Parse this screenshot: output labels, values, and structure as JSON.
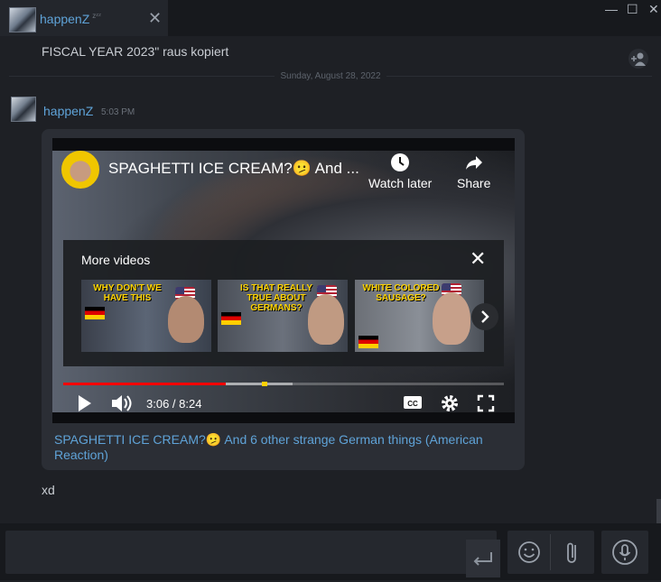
{
  "window": {
    "tab_title": "happenZ",
    "tab_status": "zᶻᶻ",
    "close_tab": "✕",
    "minimize": "—",
    "maximize": "☐",
    "close": "✕"
  },
  "chat": {
    "previous_message": "FISCAL YEAR 2023\" raus kopiert",
    "date_separator": "Sunday, August 28, 2022",
    "message": {
      "author": "happenZ",
      "time": "5:03 PM",
      "embed": {
        "video_title": "SPAGHETTI ICE CREAM?🫤 And ...",
        "watch_later": "Watch later",
        "share": "Share",
        "more_videos": {
          "title": "More videos",
          "close": "✕",
          "thumbnails": [
            {
              "text": "WHY DON'T WE HAVE THIS"
            },
            {
              "text": "IS THAT REALLY TRUE ABOUT GERMANS?"
            },
            {
              "text": "WHITE COLORED SAUSAGE?"
            }
          ]
        },
        "time_current": "3:06",
        "time_total": "8:24",
        "time_display": "3:06 / 8:24",
        "progress": 0.369,
        "buffered": 0.52,
        "link_text": "SPAGHETTI ICE CREAM?🫤 And 6 other strange German things (American Reaction)"
      }
    },
    "next_message": "xd"
  },
  "composer": {
    "placeholder": ""
  },
  "colors": {
    "accent": "#5fa3d8",
    "background": "#1e2025",
    "youtube_red": "#ff0000"
  }
}
